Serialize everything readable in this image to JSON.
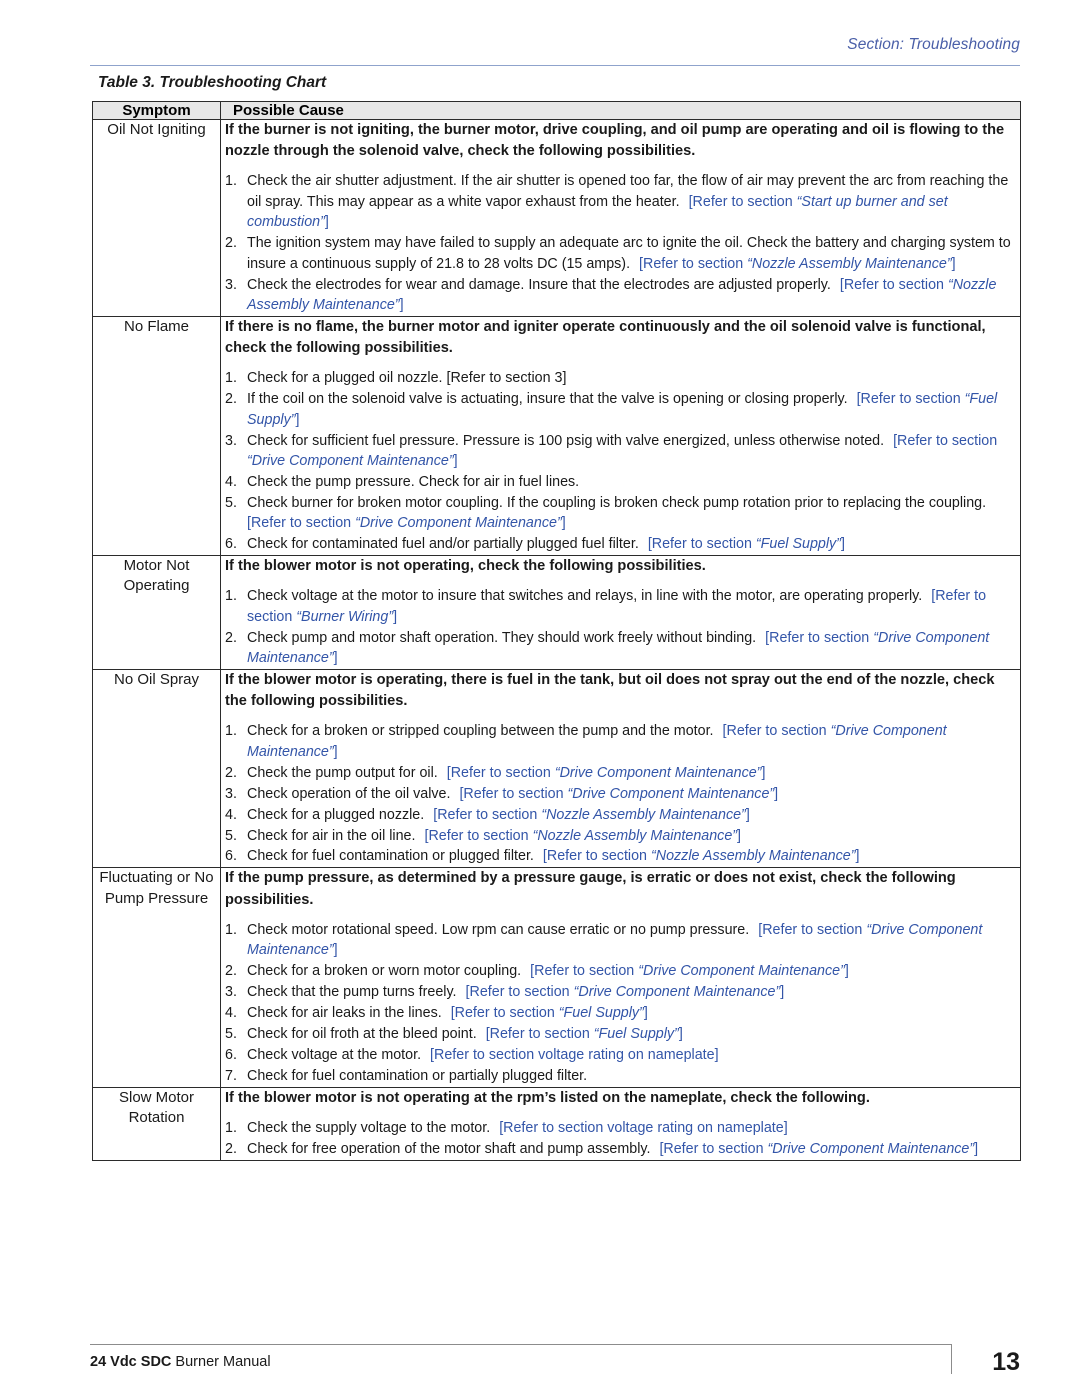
{
  "header": {
    "section_label": "Section: Troubleshooting",
    "accent_color": "#4a5fa8"
  },
  "table_caption": "Table 3. Troubleshooting Chart",
  "table": {
    "columns": [
      "Symptom",
      "Possible Cause"
    ],
    "link_color": "#3355a8",
    "rows": [
      {
        "symptom": "Oil Not Igniting",
        "intro": "If the burner is not igniting, the burner motor, drive coupling, and oil pump are operating and oil is flowing to the nozzle through the solenoid valve, check the following possibilities.",
        "steps": [
          {
            "text": "Check the air shutter adjustment. If the air shutter is opened too far, the flow of air may prevent the arc from reaching the oil spray. This may appear as a white vapor exhaust from the heater.",
            "ref_prefix": "[Refer to section",
            "ref_name": "“Start up burner and set combustion”",
            "ref_suffix": "]"
          },
          {
            "text": "The ignition system may have failed to supply an adequate arc to ignite the oil. Check the battery and charging system to insure a continuous supply of 21.8 to 28 volts DC (15 amps).",
            "ref_prefix": "[Refer to section",
            "ref_name": "“Nozzle Assembly Maintenance”",
            "ref_suffix": "]"
          },
          {
            "text": "Check the electrodes for wear and damage. Insure that the electrodes are adjusted properly.",
            "ref_prefix": "[Refer to section",
            "ref_name": "“Nozzle Assembly Maintenance”",
            "ref_suffix": "]"
          }
        ]
      },
      {
        "symptom": "No Flame",
        "intro": "If there is no flame, the burner motor and igniter operate continuously and the oil solenoid valve is functional, check the following possibilities.",
        "steps": [
          {
            "text": "Check for a plugged oil nozzle. [Refer to section 3]",
            "ref_prefix": "",
            "ref_name": "",
            "ref_suffix": ""
          },
          {
            "text": "If the coil on the solenoid valve is actuating, insure that the valve is opening or closing properly.",
            "ref_prefix": "[Refer to section",
            "ref_name": "“Fuel Supply”",
            "ref_suffix": "]"
          },
          {
            "text": "Check for sufficient fuel pressure. Pressure is 100 psig with valve energized, unless otherwise noted.",
            "ref_prefix": "[Refer to section",
            "ref_name": "“Drive Component Maintenance”",
            "ref_suffix": "]"
          },
          {
            "text": "Check the pump pressure. Check for air in fuel lines.",
            "ref_prefix": "",
            "ref_name": "",
            "ref_suffix": ""
          },
          {
            "text": "Check burner for broken motor coupling. If the coupling is broken check pump rotation prior to replacing the coupling.",
            "ref_prefix": "[Refer to section",
            "ref_name": "“Drive Component Maintenance”",
            "ref_suffix": "]"
          },
          {
            "text": "Check for contaminated fuel and/or partially plugged fuel filter.",
            "ref_prefix": "[Refer to section",
            "ref_name": "“Fuel Supply”",
            "ref_suffix": "]"
          }
        ]
      },
      {
        "symptom": "Motor Not Operating",
        "intro": "If the blower motor is not operating, check the following possibilities.",
        "steps": [
          {
            "text": "Check voltage at the motor to insure that switches and relays, in line with the motor, are operating properly.",
            "ref_prefix": "[Refer to section",
            "ref_name": "“Burner Wiring”",
            "ref_suffix": "]"
          },
          {
            "text": "Check pump and motor shaft operation. They should work freely without binding.",
            "ref_prefix": "[Refer to section",
            "ref_name": "“Drive Component Maintenance”",
            "ref_suffix": "]"
          }
        ]
      },
      {
        "symptom": "No Oil Spray",
        "intro": "If the blower motor is operating, there is fuel in the tank, but oil does not spray out the end of the nozzle, check the following possibilities.",
        "steps": [
          {
            "text": "Check for a broken or stripped coupling between the pump and the motor.",
            "ref_prefix": "[Refer to section",
            "ref_name": "“Drive Component Maintenance”",
            "ref_suffix": "]"
          },
          {
            "text": "Check the pump output for oil.",
            "ref_prefix": "[Refer to section",
            "ref_name": "“Drive Component Maintenance”",
            "ref_suffix": "]"
          },
          {
            "text": "Check operation of the oil valve.",
            "ref_prefix": "[Refer to section",
            "ref_name": "“Drive Component Maintenance”",
            "ref_suffix": "]"
          },
          {
            "text": "Check for a plugged nozzle.",
            "ref_prefix": "[Refer to section",
            "ref_name": "“Nozzle Assembly Maintenance”",
            "ref_suffix": "]"
          },
          {
            "text": "Check for air in the oil line.",
            "ref_prefix": "[Refer to section",
            "ref_name": "“Nozzle Assembly Maintenance”",
            "ref_suffix": "]"
          },
          {
            "text": "Check for fuel contamination or plugged filter.",
            "ref_prefix": "[Refer to section",
            "ref_name": "“Nozzle Assembly Maintenance”",
            "ref_suffix": "]"
          }
        ]
      },
      {
        "symptom": "Fluctuating or No Pump Pressure",
        "intro": "If the pump pressure, as determined by a pressure gauge, is erratic or does not exist, check the following possibilities.",
        "steps": [
          {
            "text": "Check motor rotational speed. Low rpm can cause erratic or no pump pressure.",
            "ref_prefix": "[Refer to section",
            "ref_name": "“Drive Component Maintenance”",
            "ref_suffix": "]"
          },
          {
            "text": "Check for a broken or worn motor coupling.",
            "ref_prefix": "[Refer to section",
            "ref_name": "“Drive Component Maintenance”",
            "ref_suffix": "]"
          },
          {
            "text": "Check that the pump turns freely.",
            "ref_prefix": "[Refer to section",
            "ref_name": "“Drive Component Maintenance”",
            "ref_suffix": "]"
          },
          {
            "text": "Check for air leaks in the lines.",
            "ref_prefix": "[Refer to section",
            "ref_name": "“Fuel Supply”",
            "ref_suffix": "]"
          },
          {
            "text": "Check for oil froth at the bleed point.",
            "ref_prefix": "[Refer to section",
            "ref_name": "“Fuel Supply”",
            "ref_suffix": "]"
          },
          {
            "text": "Check voltage at the motor.",
            "ref_prefix": "[Refer to section voltage rating on nameplate]",
            "ref_name": "",
            "ref_suffix": ""
          },
          {
            "text": "Check for fuel contamination or partially plugged filter.",
            "ref_prefix": "",
            "ref_name": "",
            "ref_suffix": ""
          }
        ]
      },
      {
        "symptom": "Slow Motor Rotation",
        "intro": "If the blower motor is not operating at the rpm’s listed on the nameplate, check the following.",
        "steps": [
          {
            "text": "Check the supply voltage to the motor.",
            "ref_prefix": "[Refer to section voltage rating on nameplate]",
            "ref_name": "",
            "ref_suffix": ""
          },
          {
            "text": "Check for free operation of the motor shaft and pump assembly.",
            "ref_prefix": "[Refer to section",
            "ref_name": "“Drive Component Maintenance”",
            "ref_suffix": "]"
          }
        ]
      }
    ]
  },
  "footer": {
    "manual_bold": "24 Vdc SDC",
    "manual_rest": " Burner Manual",
    "page_number": "13"
  }
}
